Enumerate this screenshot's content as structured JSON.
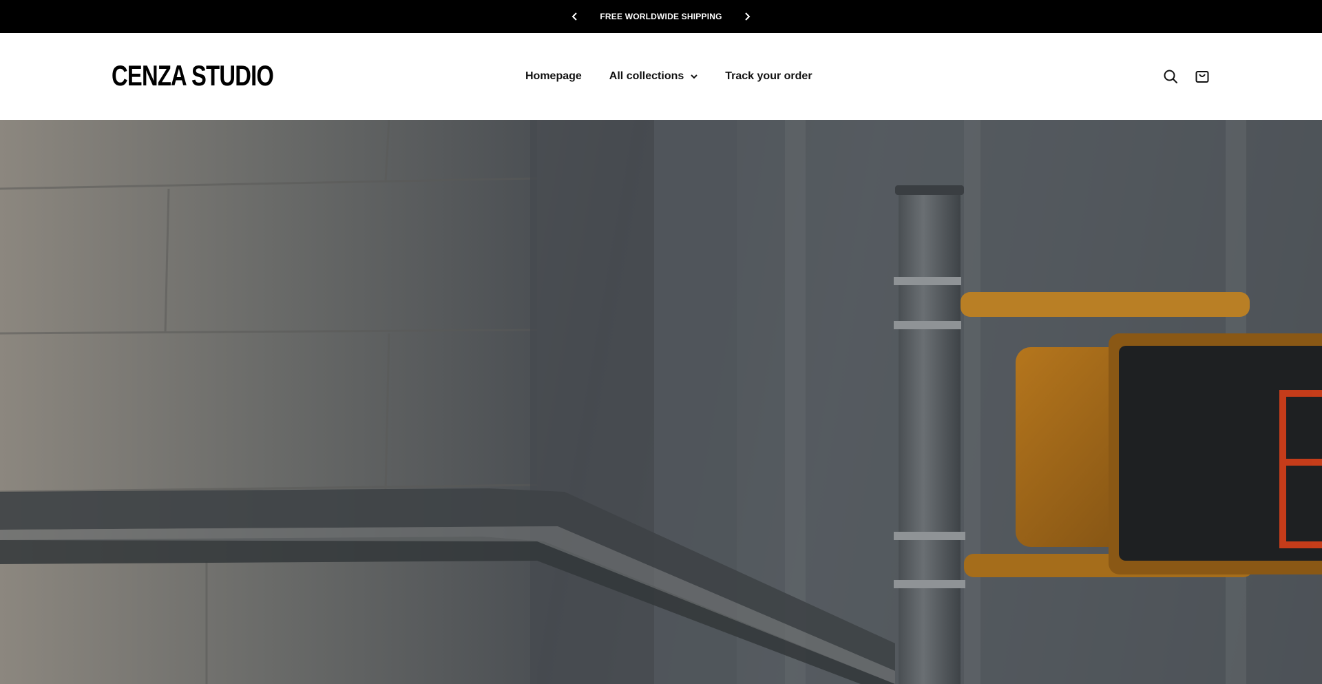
{
  "announcement": {
    "text": "FREE WORLDWIDE SHIPPING",
    "prev_icon": "chevron-left-icon",
    "next_icon": "chevron-right-icon"
  },
  "header": {
    "logo": "CENZA STUDIO",
    "nav": [
      {
        "label": "Homepage"
      },
      {
        "label": "All collections",
        "icon": "chevron-down-icon"
      },
      {
        "label": "Track your order"
      }
    ],
    "icons": [
      "search-icon",
      "cart-icon"
    ]
  },
  "hero": {
    "image": "street-corner-pedestrian-signal",
    "colors": {
      "signal": "#c4811f",
      "light": "#d8401a"
    }
  }
}
